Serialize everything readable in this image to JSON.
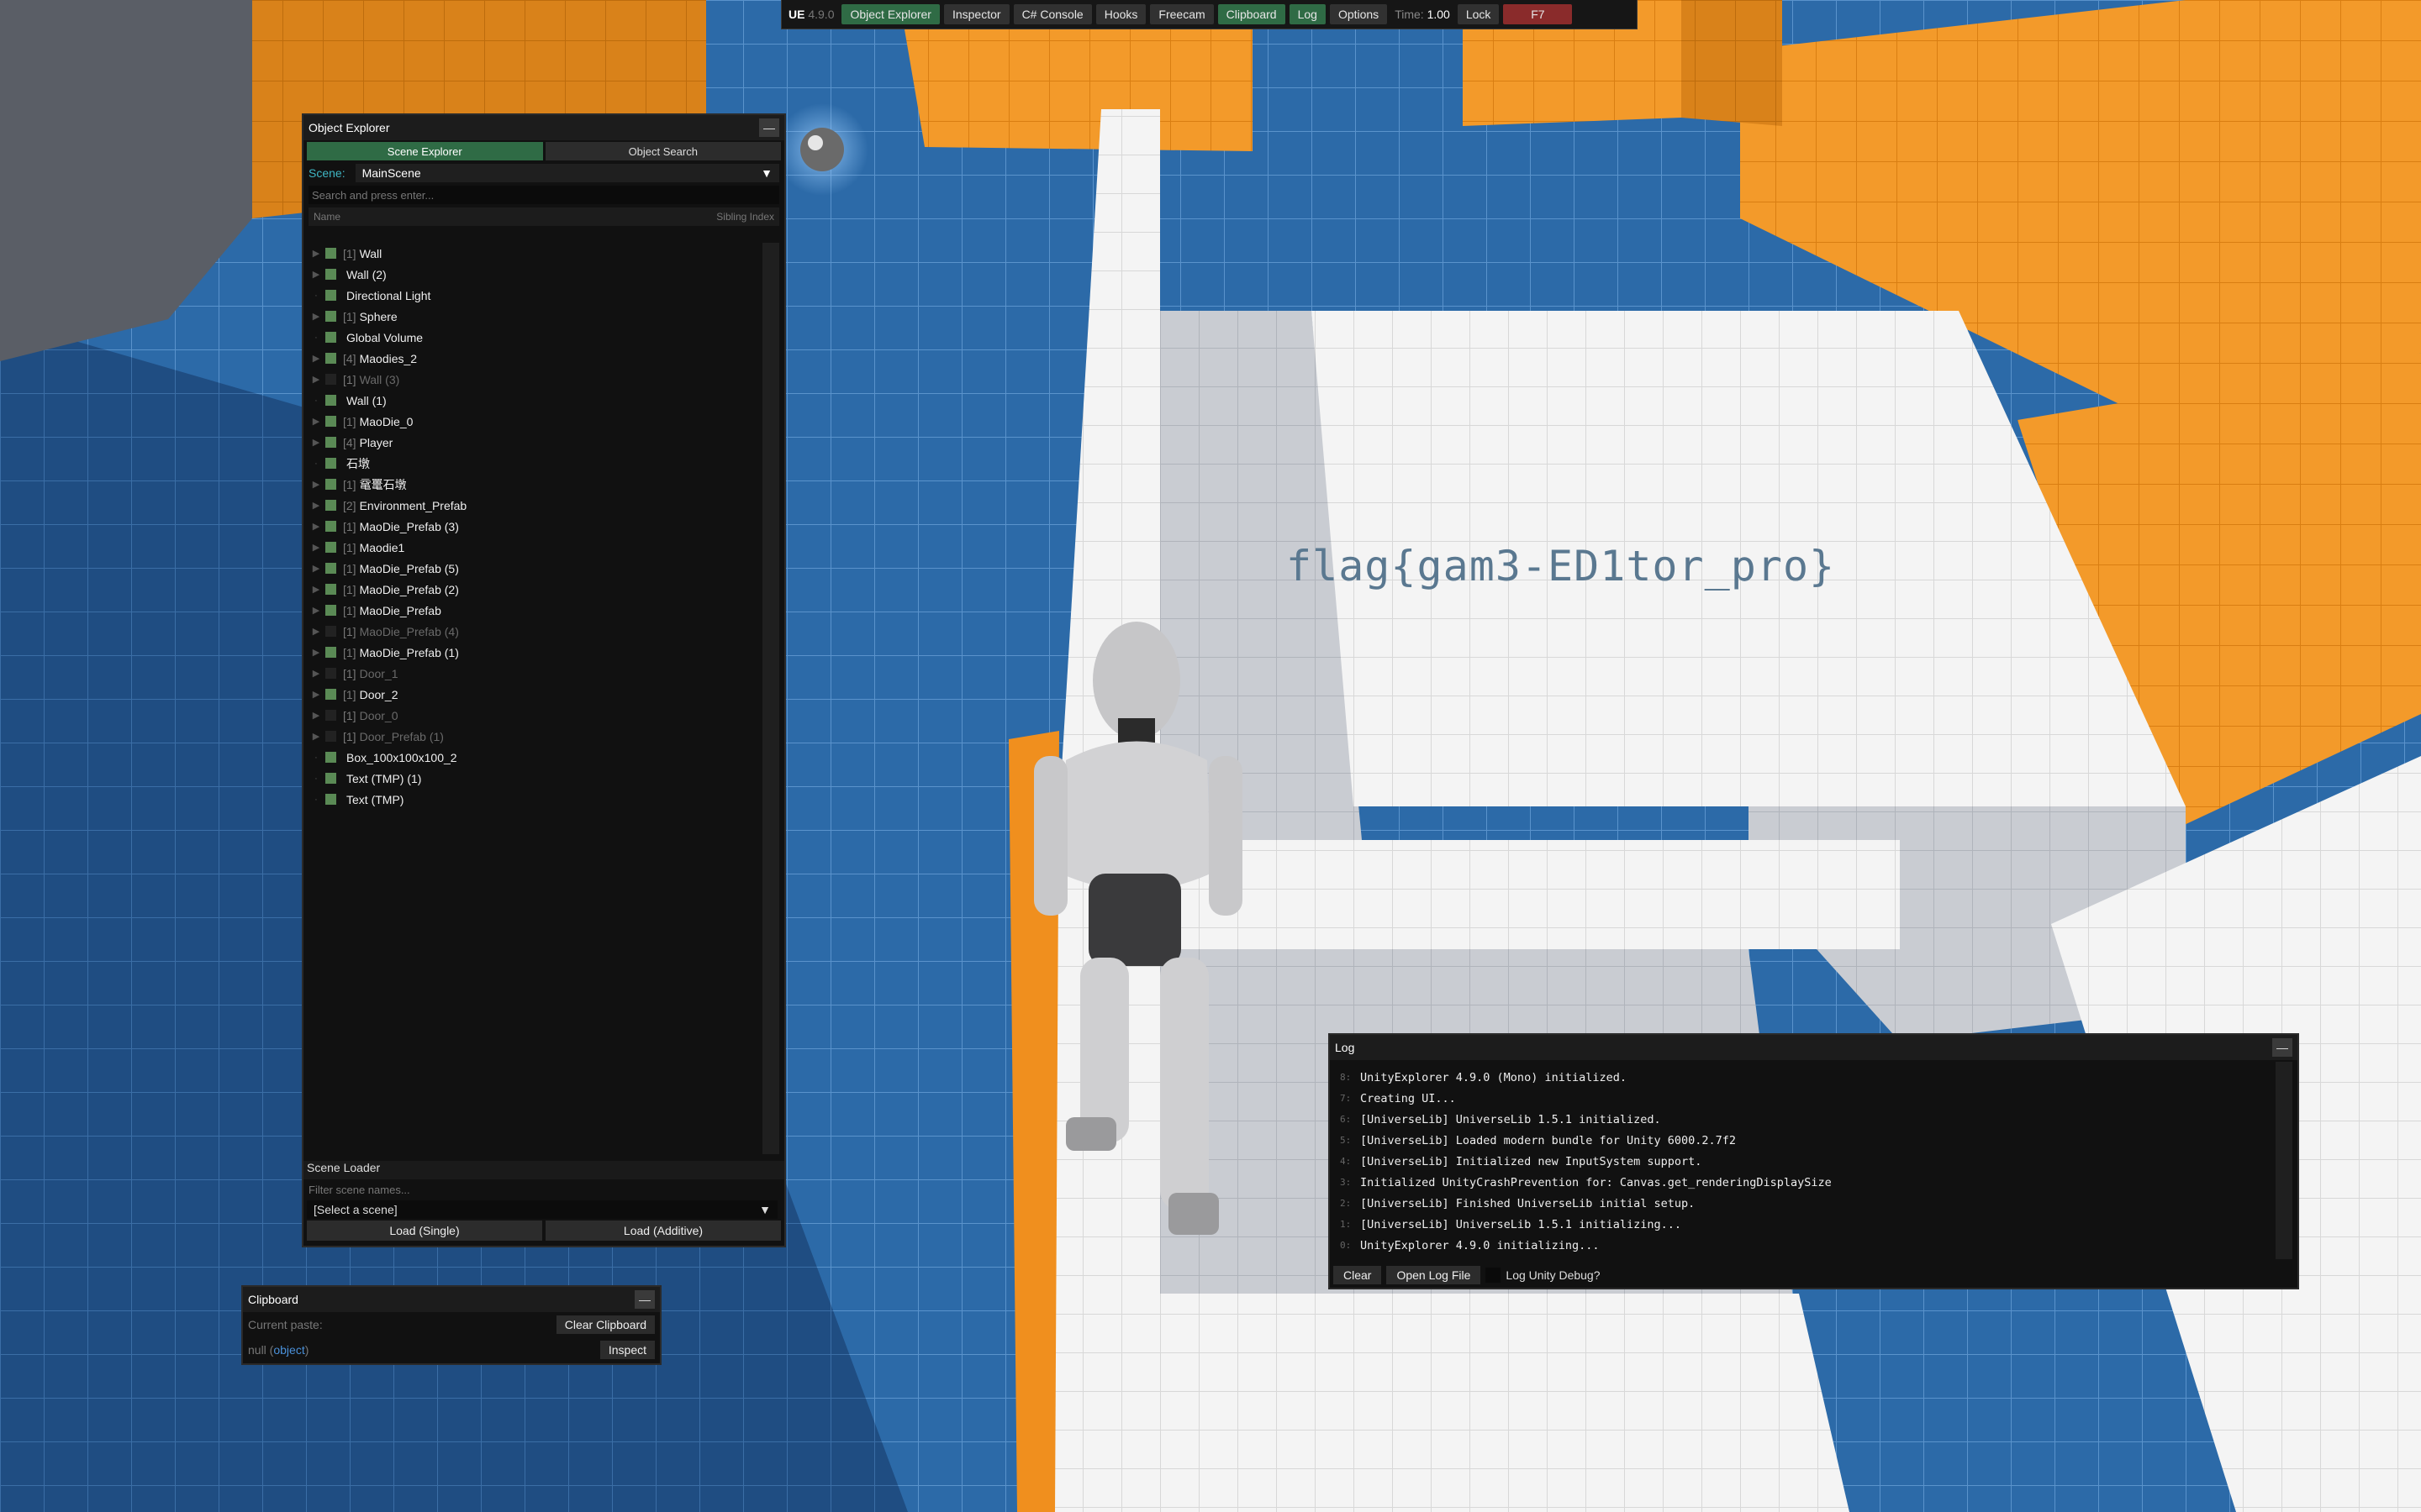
{
  "toolbar": {
    "brand": "UE",
    "version": "4.9.0",
    "buttons": [
      "Object Explorer",
      "Inspector",
      "C# Console",
      "Hooks",
      "Freecam",
      "Clipboard",
      "Log",
      "Options"
    ],
    "active": [
      "Object Explorer",
      "Clipboard",
      "Log"
    ],
    "time_label": "Time:",
    "time_value": "1.00",
    "lock_label": "Lock",
    "hotkey": "F7"
  },
  "object_explorer": {
    "title": "Object Explorer",
    "tab_scene_explorer": "Scene Explorer",
    "tab_object_search": "Object Search",
    "scene_label": "Scene:",
    "scene_value": "MainScene",
    "search_placeholder": "Search and press enter...",
    "col_name": "Name",
    "col_sibling": "Sibling Index",
    "items": [
      {
        "idx": "[1]",
        "name": "Wall",
        "active": true,
        "children": true
      },
      {
        "idx": "",
        "name": "Wall (2)",
        "active": true,
        "children": true
      },
      {
        "idx": "",
        "name": "Directional Light",
        "active": true,
        "children": false
      },
      {
        "idx": "[1]",
        "name": "Sphere",
        "active": true,
        "children": true
      },
      {
        "idx": "",
        "name": "Global Volume",
        "active": true,
        "children": false
      },
      {
        "idx": "[4]",
        "name": "Maodies_2",
        "active": true,
        "children": true
      },
      {
        "idx": "[1]",
        "name": "Wall (3)",
        "active": false,
        "children": true
      },
      {
        "idx": "",
        "name": "Wall (1)",
        "active": true,
        "children": false
      },
      {
        "idx": "[1]",
        "name": "MaoDie_0",
        "active": true,
        "children": true
      },
      {
        "idx": "[4]",
        "name": "Player",
        "active": true,
        "children": true
      },
      {
        "idx": "",
        "name": "石墩",
        "active": true,
        "children": false
      },
      {
        "idx": "[1]",
        "name": "鼋鼍石墩",
        "active": true,
        "children": true
      },
      {
        "idx": "[2]",
        "name": "Environment_Prefab",
        "active": true,
        "children": true
      },
      {
        "idx": "[1]",
        "name": "MaoDie_Prefab (3)",
        "active": true,
        "children": true
      },
      {
        "idx": "[1]",
        "name": "Maodie1",
        "active": true,
        "children": true
      },
      {
        "idx": "[1]",
        "name": "MaoDie_Prefab (5)",
        "active": true,
        "children": true
      },
      {
        "idx": "[1]",
        "name": "MaoDie_Prefab (2)",
        "active": true,
        "children": true
      },
      {
        "idx": "[1]",
        "name": "MaoDie_Prefab",
        "active": true,
        "children": true
      },
      {
        "idx": "[1]",
        "name": "MaoDie_Prefab (4)",
        "active": false,
        "children": true
      },
      {
        "idx": "[1]",
        "name": "MaoDie_Prefab (1)",
        "active": true,
        "children": true
      },
      {
        "idx": "[1]",
        "name": "Door_1",
        "active": false,
        "children": true
      },
      {
        "idx": "[1]",
        "name": "Door_2",
        "active": true,
        "children": true
      },
      {
        "idx": "[1]",
        "name": "Door_0",
        "active": false,
        "children": true
      },
      {
        "idx": "[1]",
        "name": "Door_Prefab (1)",
        "active": false,
        "children": true
      },
      {
        "idx": "",
        "name": "Box_100x100x100_2",
        "active": true,
        "children": false
      },
      {
        "idx": "",
        "name": "Text (TMP) (1)",
        "active": true,
        "children": false
      },
      {
        "idx": "",
        "name": "Text (TMP)",
        "active": true,
        "children": false
      }
    ],
    "scene_loader_title": "Scene Loader",
    "scene_filter_placeholder": "Filter scene names...",
    "scene_select": "[Select a scene]",
    "load_single": "Load (Single)",
    "load_additive": "Load (Additive)"
  },
  "clipboard": {
    "title": "Clipboard",
    "current_paste_label": "Current paste:",
    "clear_button": "Clear Clipboard",
    "null_text": "null",
    "object_text": "object",
    "inspect_button": "Inspect"
  },
  "log": {
    "title": "Log",
    "lines": [
      {
        "n": "8:",
        "text": "UnityExplorer 4.9.0 (Mono) initialized."
      },
      {
        "n": "7:",
        "text": "Creating UI..."
      },
      {
        "n": "6:",
        "text": "[UniverseLib] UniverseLib 1.5.1 initialized."
      },
      {
        "n": "5:",
        "text": "[UniverseLib] Loaded modern bundle for Unity 6000.2.7f2"
      },
      {
        "n": "4:",
        "text": "[UniverseLib] Initialized new InputSystem support."
      },
      {
        "n": "3:",
        "text": "Initialized UnityCrashPrevention for: Canvas.get_renderingDisplaySize"
      },
      {
        "n": "2:",
        "text": "[UniverseLib] Finished UniverseLib initial setup."
      },
      {
        "n": "1:",
        "text": "[UniverseLib] UniverseLib 1.5.1 initializing..."
      },
      {
        "n": "0:",
        "text": "UnityExplorer 4.9.0 initializing..."
      }
    ],
    "clear_button": "Clear",
    "open_log_button": "Open Log File",
    "debug_label": "Log Unity Debug?"
  },
  "scene": {
    "flag_text": "flag{gam3-ED1tor_pro}"
  }
}
